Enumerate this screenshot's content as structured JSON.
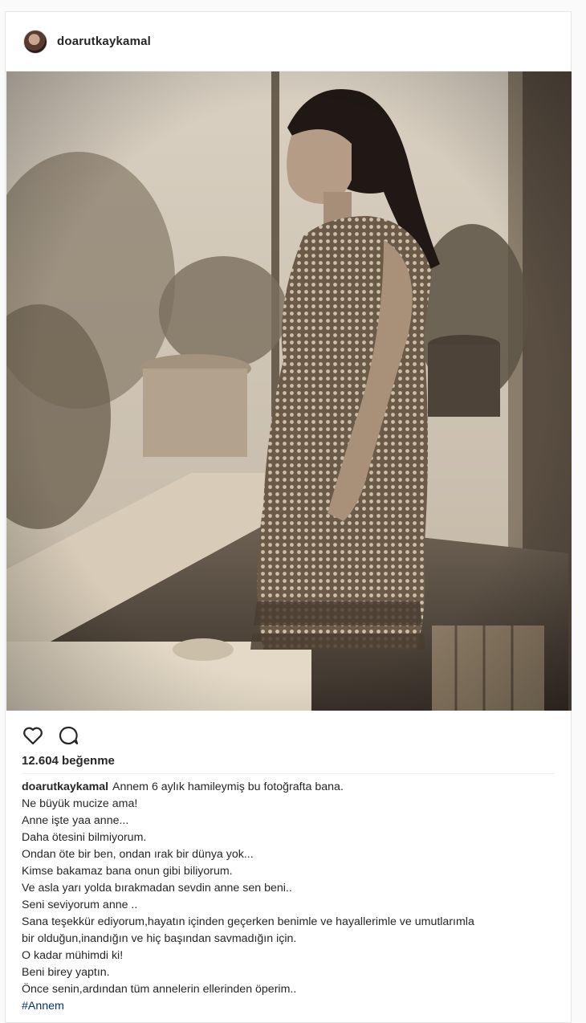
{
  "post": {
    "username": "doarutkaykamal",
    "likes": "12.604 beğenme",
    "caption": {
      "username": "doarutkaykamal",
      "lines": [
        "Annem 6 aylık hamileymiş bu fotoğrafta bana.",
        "Ne büyük mucize ama!",
        "Anne işte yaa anne...",
        "Daha ötesini bilmiyorum.",
        "Ondan öte bir ben, ondan ırak bir dünya yok...",
        "Kimse bakamaz bana onun gibi biliyorum.",
        "Ve asla yarı yolda bırakmadan sevdin anne sen beni..",
        "Seni seviyorum anne ..",
        "Sana teşekkür ediyorum,hayatın içinden geçerken benimle ve hayallerimle ve umutlarımla",
        "bir olduğun,inandığın ve hiç başından savmadığın için.",
        "O kadar mühimdi ki!",
        "Beni birey yaptın.",
        "Önce senin,ardından tüm annelerin ellerinden öperim..",
        "#Annem"
      ]
    }
  },
  "icons": {
    "like": "heart-icon",
    "comment": "comment-bubble-icon"
  },
  "colors": {
    "text": "#262626",
    "hashtag": "#003569",
    "border": "#e6e6e6",
    "background": "#fafafa"
  }
}
